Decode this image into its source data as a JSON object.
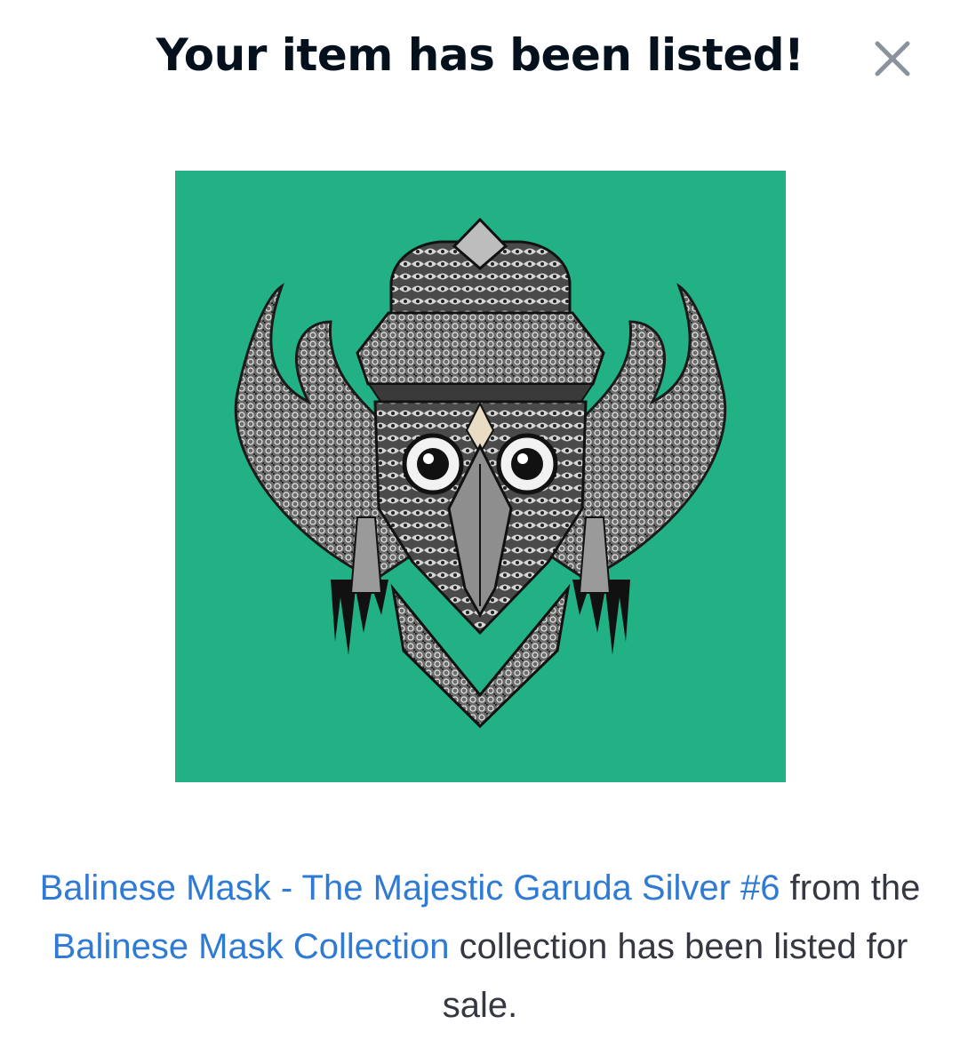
{
  "modal": {
    "title": "Your item has been listed!",
    "close_icon": "close-icon"
  },
  "artwork": {
    "background_color": "#21b185",
    "subject_icon": "garuda-mask-illustration"
  },
  "caption": {
    "item_link": "Balinese Mask - The Majestic Garuda Silver #6",
    "text_1": " from the ",
    "collection_link": "Balinese Mask Collection",
    "text_2": " collection has been listed for sale."
  },
  "colors": {
    "title": "#04111d",
    "link": "#2f7bd3",
    "body_text": "#353840"
  }
}
